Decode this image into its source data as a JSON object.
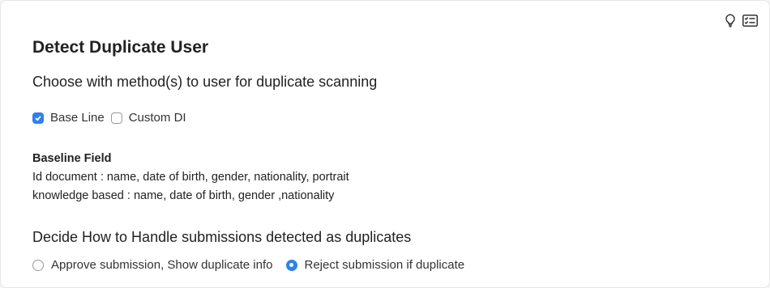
{
  "header": {
    "title": "Detect Duplicate User",
    "icons": [
      "lightbulb-icon",
      "form-list-icon"
    ]
  },
  "methods": {
    "question": "Choose with method(s) to user for duplicate scanning",
    "options": [
      {
        "label": "Base Line",
        "checked": true
      },
      {
        "label": "Custom DI",
        "checked": false
      }
    ]
  },
  "baseline": {
    "title": "Baseline Field",
    "lines": [
      "Id document : name, date of birth, gender, nationality, portrait",
      "knowledge based : name, date of birth, gender ,nationality"
    ]
  },
  "handling": {
    "question": "Decide How to Handle submissions detected as duplicates",
    "options": [
      {
        "label": "Approve submission, Show duplicate info",
        "selected": false
      },
      {
        "label": "Reject submission if duplicate",
        "selected": true
      }
    ]
  },
  "colors": {
    "accent": "#2f80ed",
    "text": "#222222"
  }
}
